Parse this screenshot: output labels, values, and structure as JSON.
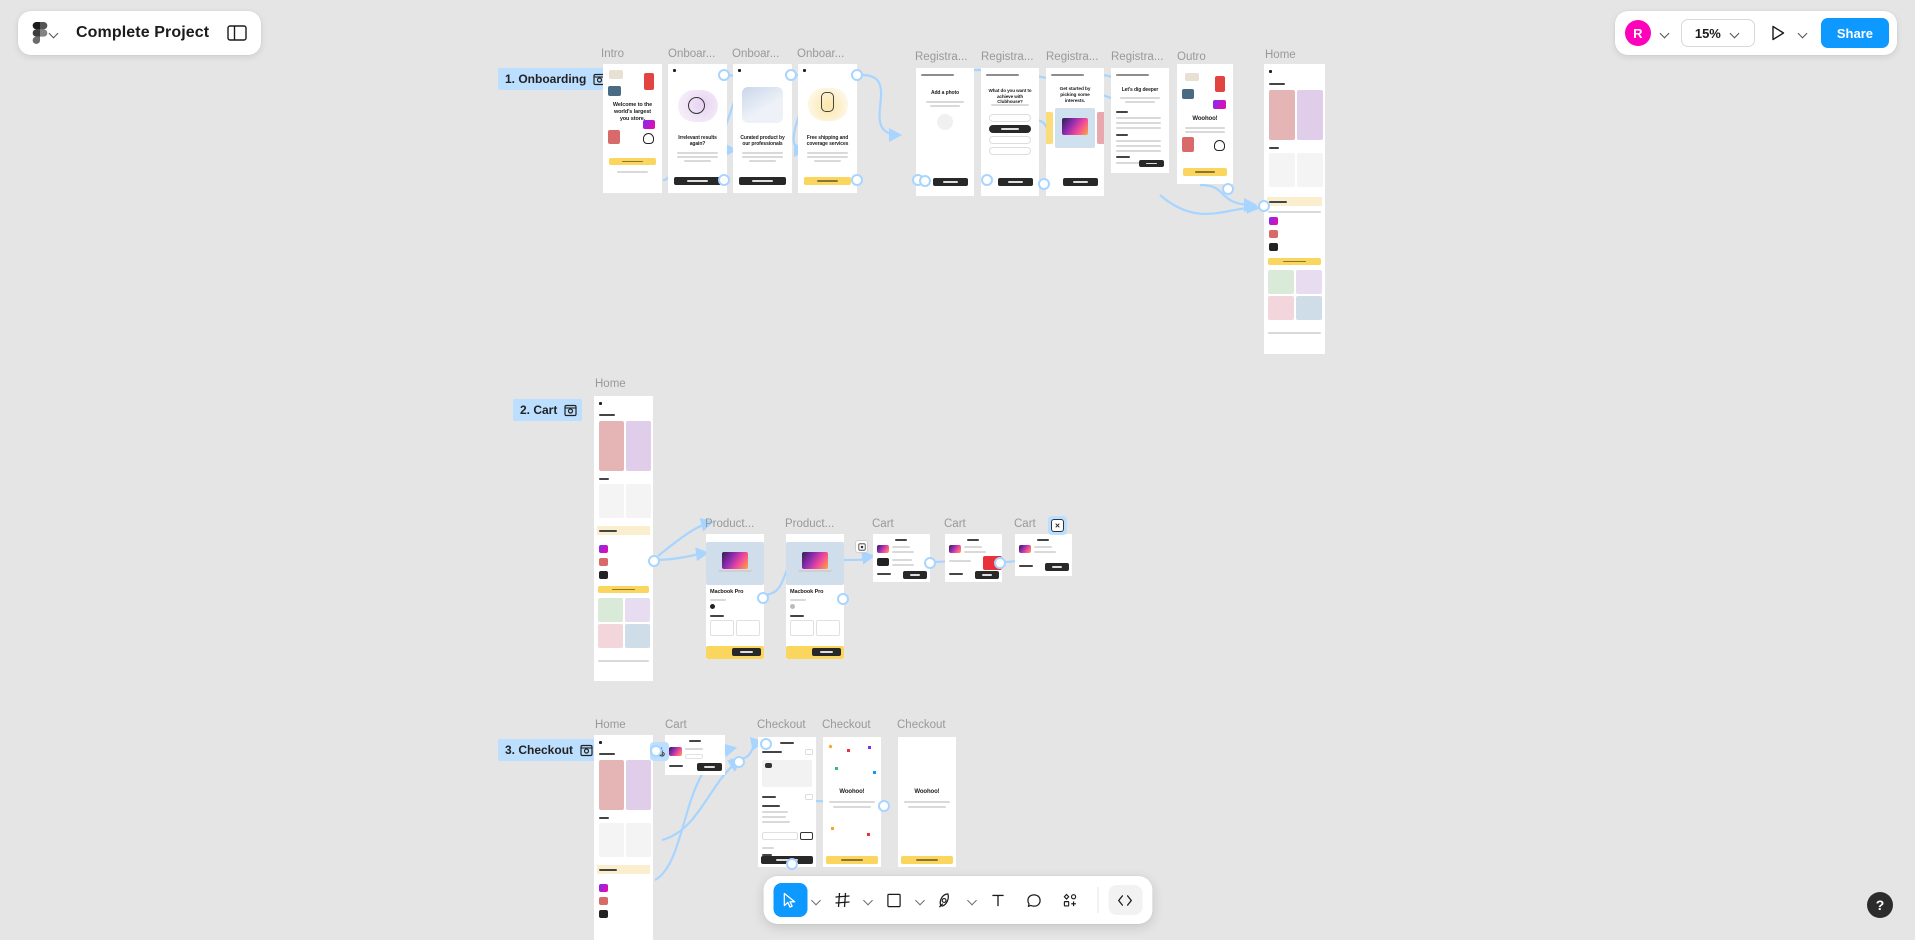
{
  "app": {
    "title": "Complete Project",
    "logo_icon": "figma-logo-icon",
    "menu_chevron_icon": "chevron-down-icon",
    "panel_toggle_icon": "sidebar-panel-icon"
  },
  "topbar": {
    "avatar_initial": "R",
    "avatar_color": "#ff00bb",
    "avatar_chevron_icon": "chevron-down-icon",
    "zoom_level": "15%",
    "zoom_chevron_icon": "chevron-down-icon",
    "present_icon": "play-icon",
    "present_chevron_icon": "chevron-down-icon",
    "share_label": "Share",
    "share_color": "#0d99ff"
  },
  "toolbar": {
    "tools": [
      {
        "name": "move-tool",
        "icon": "cursor-icon",
        "active": true,
        "has_chevron": true
      },
      {
        "name": "frame-tool",
        "icon": "frame-grid-icon",
        "active": false,
        "has_chevron": true
      },
      {
        "name": "shape-tool",
        "icon": "square-icon",
        "active": false,
        "has_chevron": true
      },
      {
        "name": "pen-tool",
        "icon": "pen-nib-icon",
        "active": false,
        "has_chevron": true
      },
      {
        "name": "text-tool",
        "icon": "text-T-icon",
        "active": false,
        "has_chevron": false
      },
      {
        "name": "comment-tool",
        "icon": "comment-bubble-icon",
        "active": false,
        "has_chevron": false
      },
      {
        "name": "actions-tool",
        "icon": "plugins-shapes-icon",
        "active": false,
        "has_chevron": false
      }
    ],
    "dev_mode_icon": "code-brackets-icon"
  },
  "help": {
    "label": "?",
    "icon": "question-mark-icon"
  },
  "sections": [
    {
      "label": "1. Onboarding",
      "icon": "section-prototype-icon"
    },
    {
      "label": "2. Cart",
      "icon": "section-prototype-icon"
    },
    {
      "label": "3. Checkout",
      "icon": "section-prototype-icon"
    }
  ],
  "frames": {
    "row1": [
      {
        "label": "Intro",
        "title": "Welcome to the world's largest you store.",
        "cta": "Let's begin",
        "sub": "Already have an account?"
      },
      {
        "label": "Onboar...",
        "title": "Irrelevant results again?",
        "cta": "Next"
      },
      {
        "label": "Onboar...",
        "title": "Curated product by our professionals",
        "cta": "Next"
      },
      {
        "label": "Onboar...",
        "title": "Free shipping and coverage services",
        "cta": "Sign me up"
      },
      {
        "label": "Registra...",
        "title": "Add a photo",
        "cta": "Select my photo"
      },
      {
        "label": "Registra...",
        "title": "What do you want to achieve with Clubhouse?",
        "cta": "Continue"
      },
      {
        "label": "Registra...",
        "title": "Get started by picking some interests.",
        "cta": "Continue"
      },
      {
        "label": "Registra...",
        "title": "Let's dig deeper",
        "cta": "Continue"
      },
      {
        "label": "Outro",
        "title": "Woohoo!",
        "cta": "Let the hunt begin!"
      },
      {
        "label": "Home",
        "title": "Just for you",
        "section2": "Deals",
        "section3": "My Collections"
      }
    ],
    "row2": [
      {
        "label": "Home",
        "title": "Just for you"
      },
      {
        "label": "Product...",
        "title": "Macbook Pro",
        "cta": "Add to cart"
      },
      {
        "label": "Product...",
        "title": "Macbook Pro",
        "cta": "Added"
      },
      {
        "label": "Cart",
        "title": "Cart",
        "cta": "Checkout"
      },
      {
        "label": "Cart",
        "title": "Cart",
        "cta": "Checkout"
      },
      {
        "label": "Cart",
        "title": "Cart",
        "cta": "Checkout"
      }
    ],
    "row3": [
      {
        "label": "Home",
        "title": "Just for you"
      },
      {
        "label": "Cart",
        "title": "Cart",
        "cta": "Checkout"
      },
      {
        "label": "Checkout",
        "title": "Checkout",
        "cta": "Pay now"
      },
      {
        "label": "Checkout",
        "title": "Woohoo!",
        "cta": "Add More"
      },
      {
        "label": "Checkout",
        "title": "Woohoo!",
        "cta": "Continue"
      }
    ]
  },
  "prototype": {
    "connector_color": "#a8d5ff",
    "hotspot_fill": "#ffffff",
    "badge_icons": [
      "prototype-interaction-icon",
      "swap-overlay-icon",
      "close-overlay-icon"
    ],
    "selected_badge_icon": "close-overlay-icon"
  },
  "canvas": {
    "background": "#e5e5e5"
  }
}
